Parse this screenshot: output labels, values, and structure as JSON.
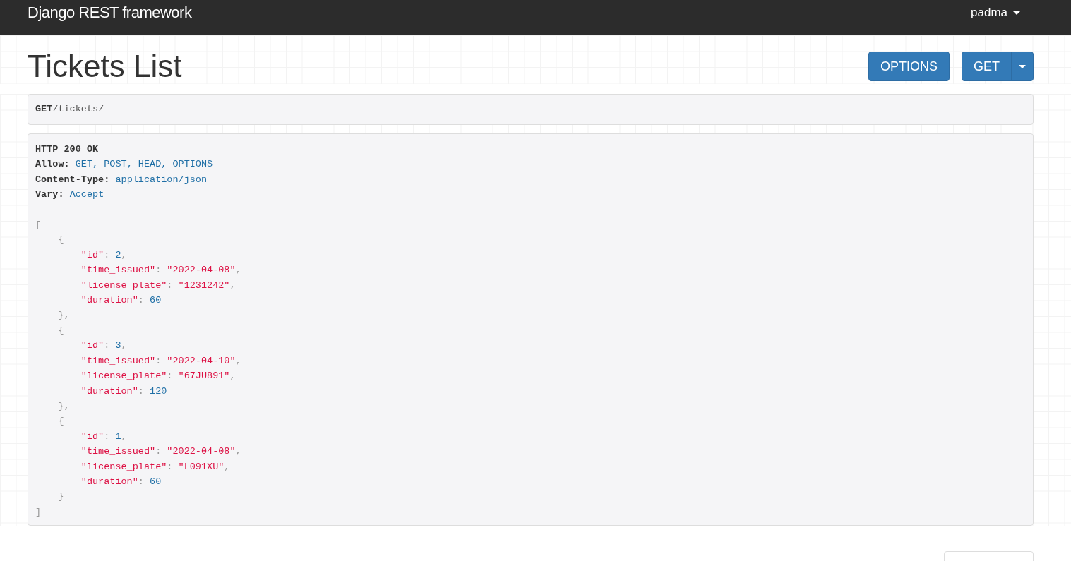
{
  "navbar": {
    "brand": "Django REST framework",
    "user": "padma"
  },
  "page": {
    "title": "Tickets List"
  },
  "actions": {
    "options_label": "OPTIONS",
    "get_label": "GET"
  },
  "request": {
    "method": "GET",
    "path": "/tickets/"
  },
  "response": {
    "status": "HTTP 200 OK",
    "headers": [
      {
        "name": "Allow:",
        "value": "GET, POST, HEAD, OPTIONS"
      },
      {
        "name": "Content-Type:",
        "value": "application/json"
      },
      {
        "name": "Vary:",
        "value": "Accept"
      }
    ],
    "body_lines": [
      [
        {
          "kind": "punct",
          "text": "["
        }
      ],
      [
        {
          "kind": "punct",
          "text": "    {"
        }
      ],
      [
        {
          "kind": "key",
          "text": "        \"id\""
        },
        {
          "kind": "punct",
          "text": ": "
        },
        {
          "kind": "number",
          "text": "2"
        },
        {
          "kind": "punct",
          "text": ","
        }
      ],
      [
        {
          "kind": "key",
          "text": "        \"time_issued\""
        },
        {
          "kind": "punct",
          "text": ": "
        },
        {
          "kind": "string",
          "text": "\"2022-04-08\""
        },
        {
          "kind": "punct",
          "text": ","
        }
      ],
      [
        {
          "kind": "key",
          "text": "        \"license_plate\""
        },
        {
          "kind": "punct",
          "text": ": "
        },
        {
          "kind": "string",
          "text": "\"1231242\""
        },
        {
          "kind": "punct",
          "text": ","
        }
      ],
      [
        {
          "kind": "key",
          "text": "        \"duration\""
        },
        {
          "kind": "punct",
          "text": ": "
        },
        {
          "kind": "number",
          "text": "60"
        }
      ],
      [
        {
          "kind": "punct",
          "text": "    },"
        }
      ],
      [
        {
          "kind": "punct",
          "text": "    {"
        }
      ],
      [
        {
          "kind": "key",
          "text": "        \"id\""
        },
        {
          "kind": "punct",
          "text": ": "
        },
        {
          "kind": "number",
          "text": "3"
        },
        {
          "kind": "punct",
          "text": ","
        }
      ],
      [
        {
          "kind": "key",
          "text": "        \"time_issued\""
        },
        {
          "kind": "punct",
          "text": ": "
        },
        {
          "kind": "string",
          "text": "\"2022-04-10\""
        },
        {
          "kind": "punct",
          "text": ","
        }
      ],
      [
        {
          "kind": "key",
          "text": "        \"license_plate\""
        },
        {
          "kind": "punct",
          "text": ": "
        },
        {
          "kind": "string",
          "text": "\"67JU891\""
        },
        {
          "kind": "punct",
          "text": ","
        }
      ],
      [
        {
          "kind": "key",
          "text": "        \"duration\""
        },
        {
          "kind": "punct",
          "text": ": "
        },
        {
          "kind": "number",
          "text": "120"
        }
      ],
      [
        {
          "kind": "punct",
          "text": "    },"
        }
      ],
      [
        {
          "kind": "punct",
          "text": "    {"
        }
      ],
      [
        {
          "kind": "key",
          "text": "        \"id\""
        },
        {
          "kind": "punct",
          "text": ": "
        },
        {
          "kind": "number",
          "text": "1"
        },
        {
          "kind": "punct",
          "text": ","
        }
      ],
      [
        {
          "kind": "key",
          "text": "        \"time_issued\""
        },
        {
          "kind": "punct",
          "text": ": "
        },
        {
          "kind": "string",
          "text": "\"2022-04-08\""
        },
        {
          "kind": "punct",
          "text": ","
        }
      ],
      [
        {
          "kind": "key",
          "text": "        \"license_plate\""
        },
        {
          "kind": "punct",
          "text": ": "
        },
        {
          "kind": "string",
          "text": "\"L091XU\""
        },
        {
          "kind": "punct",
          "text": ","
        }
      ],
      [
        {
          "kind": "key",
          "text": "        \"duration\""
        },
        {
          "kind": "punct",
          "text": ": "
        },
        {
          "kind": "number",
          "text": "60"
        }
      ],
      [
        {
          "kind": "punct",
          "text": "    }"
        }
      ],
      [
        {
          "kind": "punct",
          "text": "]"
        }
      ]
    ]
  }
}
